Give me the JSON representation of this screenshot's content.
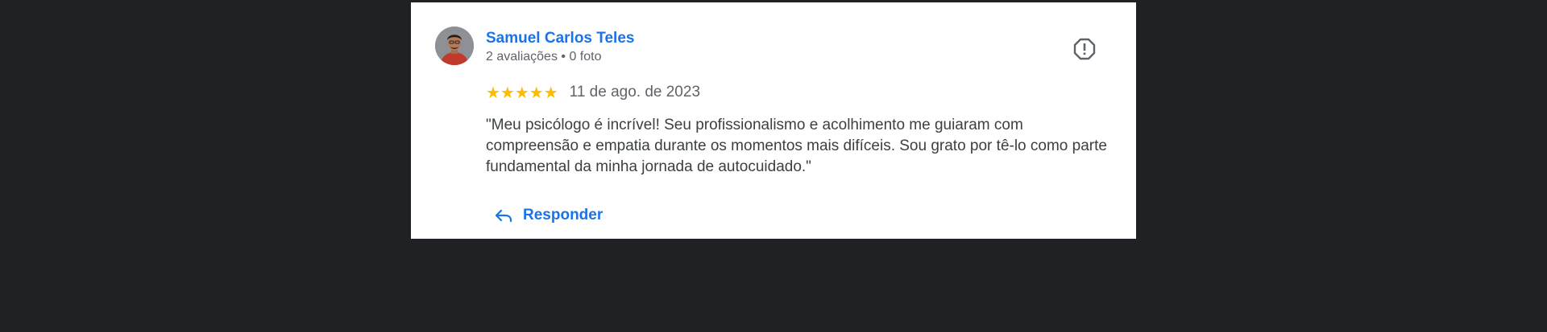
{
  "review": {
    "reviewer_name": "Samuel Carlos Teles",
    "reviewer_meta": "2 avaliações • 0 foto",
    "rating": 5,
    "rating_max": 5,
    "stars": "★★★★★",
    "date": "11 de ago. de 2023",
    "text": "\"Meu psicólogo é incrível! Seu profissionalismo e acolhimento me guiaram com compreensão e empatia durante os momentos mais difíceis. Sou grato por tê-lo como parte fundamental da minha jornada de autocuidado.\"",
    "reply_label": "Responder"
  },
  "icons": {
    "flag": "report-flag-icon",
    "reply": "reply-arrow-icon",
    "avatar": "reviewer-photo"
  },
  "colors": {
    "background": "#202124",
    "card": "#ffffff",
    "link_blue": "#1a73e8",
    "star_yellow": "#fbbc04",
    "meta_gray": "#5f6368",
    "text": "#3c4043"
  }
}
